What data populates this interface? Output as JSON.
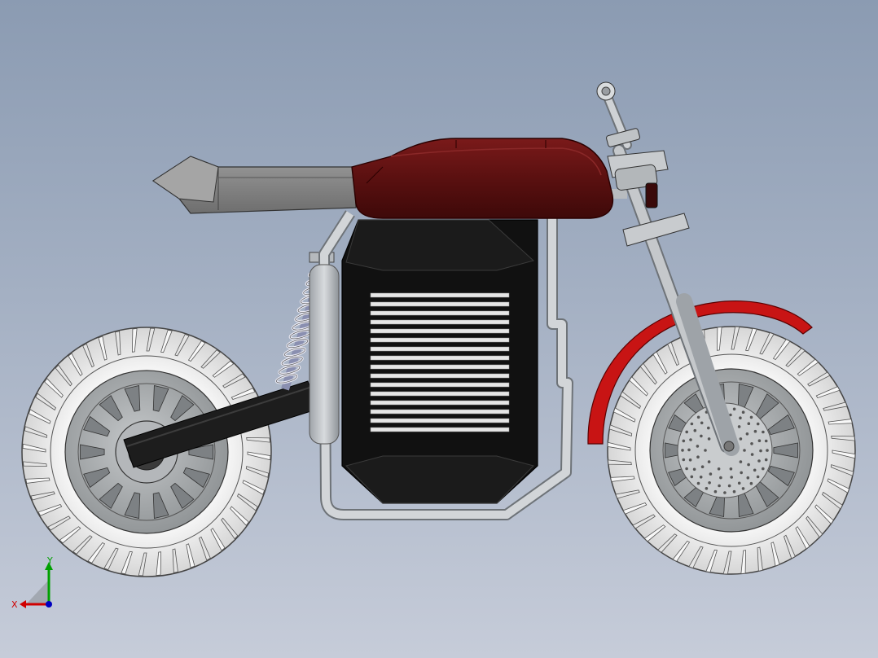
{
  "viewport": {
    "model": "electric-motorcycle",
    "view": "right-side-orthographic"
  },
  "colors": {
    "background_top": "#8b9bb2",
    "background_bottom": "#c6ccd9",
    "tank": "#5e1212",
    "fender": "#c81414",
    "battery": "#121212",
    "frame": "#b8bcc0",
    "tire": "#efefef",
    "rim": "#a8abad"
  },
  "triad": {
    "x_label": "X",
    "y_label": "Y",
    "x_color": "#d00000",
    "y_color": "#00a000",
    "z_color": "#0000c0"
  }
}
